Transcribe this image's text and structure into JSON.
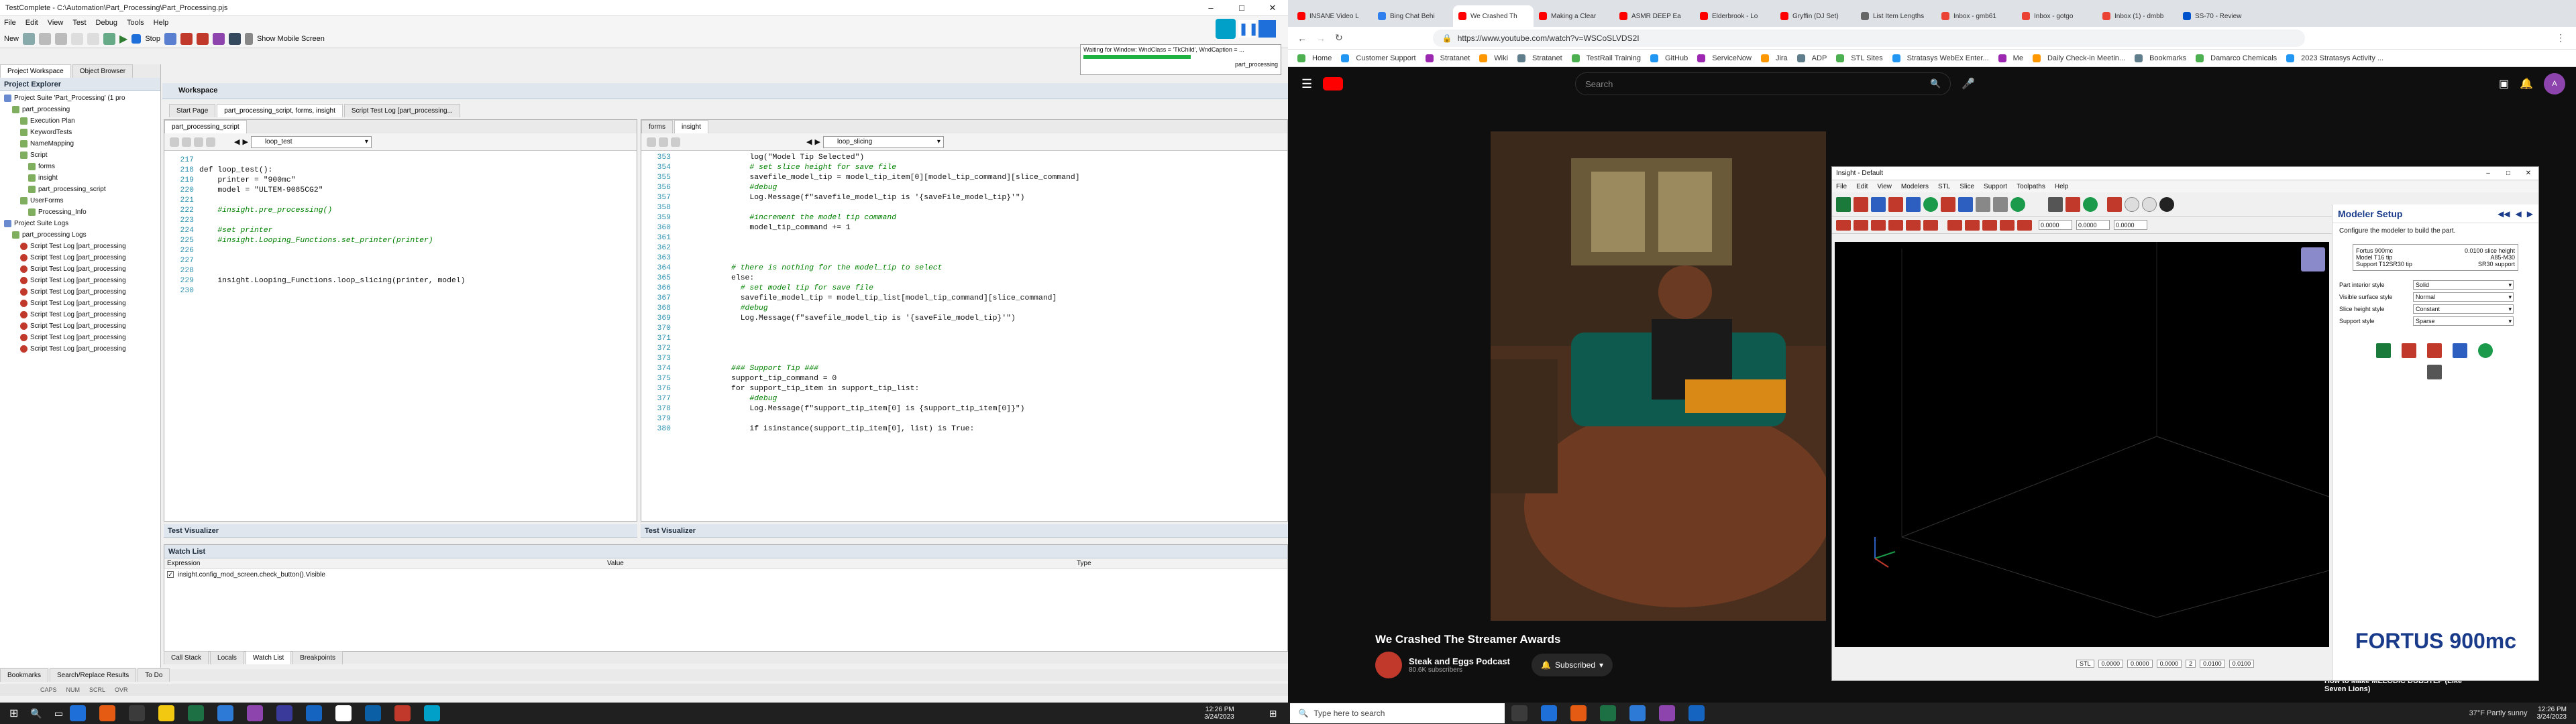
{
  "testcomplete": {
    "title": "TestComplete - C:\\Automation\\Part_Processing\\Part_Processing.pjs",
    "menu": [
      "File",
      "Edit",
      "View",
      "Test",
      "Debug",
      "Tools",
      "Help"
    ],
    "toolbar": {
      "new_label": "New",
      "run_label": "Run",
      "stop_label": "Stop",
      "mobile_label": "Show Mobile Screen"
    },
    "tabs_left": [
      "Project Workspace",
      "Object Browser"
    ],
    "project_explorer_title": "Project Explorer",
    "tree": [
      {
        "label": "Project Suite 'Part_Processing' (1 pro",
        "level": 0
      },
      {
        "label": "part_processing",
        "level": 1
      },
      {
        "label": "Execution Plan",
        "level": 2
      },
      {
        "label": "KeywordTests",
        "level": 2
      },
      {
        "label": "NameMapping",
        "level": 2
      },
      {
        "label": "Script",
        "level": 2
      },
      {
        "label": "forms",
        "level": 3
      },
      {
        "label": "insight",
        "level": 3
      },
      {
        "label": "part_processing_script",
        "level": 3
      },
      {
        "label": "UserForms",
        "level": 2
      },
      {
        "label": "Processing_Info",
        "level": 3
      },
      {
        "label": "Project Suite Logs",
        "level": 0
      },
      {
        "label": "part_processing Logs",
        "level": 1
      },
      {
        "label": "Script Test Log [part_processing",
        "level": 2
      },
      {
        "label": "Script Test Log [part_processing",
        "level": 2
      },
      {
        "label": "Script Test Log [part_processing",
        "level": 2
      },
      {
        "label": "Script Test Log [part_processing",
        "level": 2
      },
      {
        "label": "Script Test Log [part_processing",
        "level": 2
      },
      {
        "label": "Script Test Log [part_processing",
        "level": 2
      },
      {
        "label": "Script Test Log [part_processing",
        "level": 2
      },
      {
        "label": "Script Test Log [part_processing",
        "level": 2
      },
      {
        "label": "Script Test Log [part_processing",
        "level": 2
      },
      {
        "label": "Script Test Log [part_processing",
        "level": 2
      }
    ],
    "workspace_title": "Workspace",
    "workspace_tabs": [
      "Start Page",
      "part_processing_script, forms, insight",
      "Script Test Log [part_processing..."
    ],
    "left_editor": {
      "tab": "part_processing_script",
      "routine": "loop_test",
      "lines": [
        {
          "n": "217",
          "t": ""
        },
        {
          "n": "218",
          "t": "def loop_test():"
        },
        {
          "n": "219",
          "t": "    printer = \"900mc\""
        },
        {
          "n": "220",
          "t": "    model = \"ULTEM-9085CG2\""
        },
        {
          "n": "221",
          "t": ""
        },
        {
          "n": "222",
          "t": "    #insight.pre_processing()"
        },
        {
          "n": "223",
          "t": ""
        },
        {
          "n": "224",
          "t": "    #set printer"
        },
        {
          "n": "225",
          "t": "    #insight.Looping_Functions.set_printer(printer)"
        },
        {
          "n": "226",
          "t": ""
        },
        {
          "n": "227",
          "t": ""
        },
        {
          "n": "228",
          "t": ""
        },
        {
          "n": "229",
          "t": "    insight.Looping_Functions.loop_slicing(printer, model)"
        },
        {
          "n": "230",
          "t": ""
        }
      ]
    },
    "right_editor": {
      "tabs": [
        "forms",
        "insight"
      ],
      "routine": "loop_slicing",
      "lines": [
        {
          "n": "353",
          "t": "                log(\"Model Tip Selected\")"
        },
        {
          "n": "354",
          "t": "                # set slice height for save file"
        },
        {
          "n": "355",
          "t": "                savefile_model_tip = model_tip_item[0][model_tip_command][slice_command]"
        },
        {
          "n": "356",
          "t": "                #debug"
        },
        {
          "n": "357",
          "t": "                Log.Message(f\"savefile_model_tip is '{saveFile_model_tip}'\")"
        },
        {
          "n": "358",
          "t": ""
        },
        {
          "n": "359",
          "t": "                #increment the model tip command"
        },
        {
          "n": "360",
          "t": "                model_tip_command += 1"
        },
        {
          "n": "361",
          "t": ""
        },
        {
          "n": "362",
          "t": ""
        },
        {
          "n": "363",
          "t": ""
        },
        {
          "n": "364",
          "t": "            # there is nothing for the model_tip to select"
        },
        {
          "n": "365",
          "t": "            else:"
        },
        {
          "n": "366",
          "t": "              # set model tip for save file"
        },
        {
          "n": "367",
          "t": "              savefile_model_tip = model_tip_list[model_tip_command][slice_command]"
        },
        {
          "n": "368",
          "t": "              #debug"
        },
        {
          "n": "369",
          "t": "              Log.Message(f\"savefile_model_tip is '{saveFile_model_tip}'\")"
        },
        {
          "n": "370",
          "t": ""
        },
        {
          "n": "371",
          "t": ""
        },
        {
          "n": "372",
          "t": ""
        },
        {
          "n": "373",
          "t": ""
        },
        {
          "n": "374",
          "t": "            ### Support Tip ###"
        },
        {
          "n": "375",
          "t": "            support_tip_command = 0"
        },
        {
          "n": "376",
          "t": "            for support_tip_item in support_tip_list:"
        },
        {
          "n": "377",
          "t": "                #debug"
        },
        {
          "n": "378",
          "t": "                Log.Message(f\"support_tip_item[0] is {support_tip_item[0]}\")"
        },
        {
          "n": "379",
          "t": ""
        },
        {
          "n": "380",
          "t": "                if isinstance(support_tip_item[0], list) is True:"
        }
      ]
    },
    "visualizer_left": "Test Visualizer",
    "visualizer_right": "Test Visualizer",
    "watch_title": "Watch List",
    "watch_cols": [
      "Expression",
      "Value",
      "Type"
    ],
    "watch_row": "insight.config_mod_screen.check_button().Visible",
    "bottom_tabs": [
      "Call Stack",
      "Locals",
      "Watch List",
      "Breakpoints"
    ],
    "left_bottom_tabs": [
      "Bookmarks",
      "Search/Replace Results",
      "To Do"
    ],
    "status": [
      "CAPS",
      "NUM",
      "SCRL",
      "OVR"
    ],
    "waiting_text": "Waiting for Window: WndClass = 'TkChild', WndCaption = ...",
    "waiting_sub": "part_processing"
  },
  "browser": {
    "tabs": [
      "INSANE Video L",
      "Bing Chat Behi",
      "We Crashed Th",
      "Making a Clear",
      "ASMR DEEP Ea",
      "Elderbrook - Lo",
      "Gryffin (DJ Set)",
      "List Item Lengths",
      "Inbox - gmb61",
      "Inbox - gotgo",
      "Inbox (1) - dmbb",
      "SS-70 - Review"
    ],
    "active_tab": 2,
    "url": "https://www.youtube.com/watch?v=WSCoSLVDS2I",
    "bookmarks": [
      "Home",
      "Customer Support",
      "Stratanet",
      "Wiki",
      "Stratanet",
      "TestRail Training",
      "GitHub",
      "ServiceNow",
      "Jira",
      "ADP",
      "STL Sites",
      "Stratasys WebEx Enter...",
      "Me",
      "Daily Check-in Meetin...",
      "Bookmarks",
      "Damarco Chemicals",
      "2023 Stratasys Activity ..."
    ],
    "search_placeholder": "Search",
    "video_title": "We Crashed The Streamer Awards",
    "channel": "Steak and Eggs Podcast",
    "subscribers": "80.6K subscribers",
    "subscribed_label": "Subscribed",
    "next_video": "How to Make MELODIC DUBSTEP (Like Seven Lions)"
  },
  "insight": {
    "title": "Insight - Default",
    "menu": [
      "File",
      "Edit",
      "View",
      "Modelers",
      "STL",
      "Slice",
      "Support",
      "Toolpaths",
      "Help"
    ],
    "coords": [
      "0.0000",
      "0.0000",
      "0.0000"
    ],
    "modeler_setup_title": "Modeler Setup",
    "modeler_setup_desc": "Configure the modeler to build the part.",
    "specs": [
      [
        "Fortus 900mc",
        "0.0100 slice height"
      ],
      [
        "Model  T16 tip",
        "A85-M30"
      ],
      [
        "Support  T12SR30 tip",
        "SR30 support"
      ]
    ],
    "settings": [
      {
        "label": "Part interior style",
        "value": "Solid"
      },
      {
        "label": "Visible surface style",
        "value": "Normal"
      },
      {
        "label": "Slice height style",
        "value": "Constant"
      },
      {
        "label": "Support style",
        "value": "Sparse"
      }
    ],
    "brand": "FORTUS 900mc",
    "status_values": [
      "STL",
      "0.0000",
      "0.0000",
      "0.0000",
      "2",
      "0.0100",
      "0.0100"
    ]
  },
  "taskbar": {
    "search_placeholder": "Type here to search",
    "weather": "37°F  Partly sunny",
    "time_left": "12:26 PM",
    "date_left": "3/24/2023",
    "time_right": "12:26 PM",
    "date_right": "3/24/2023"
  }
}
